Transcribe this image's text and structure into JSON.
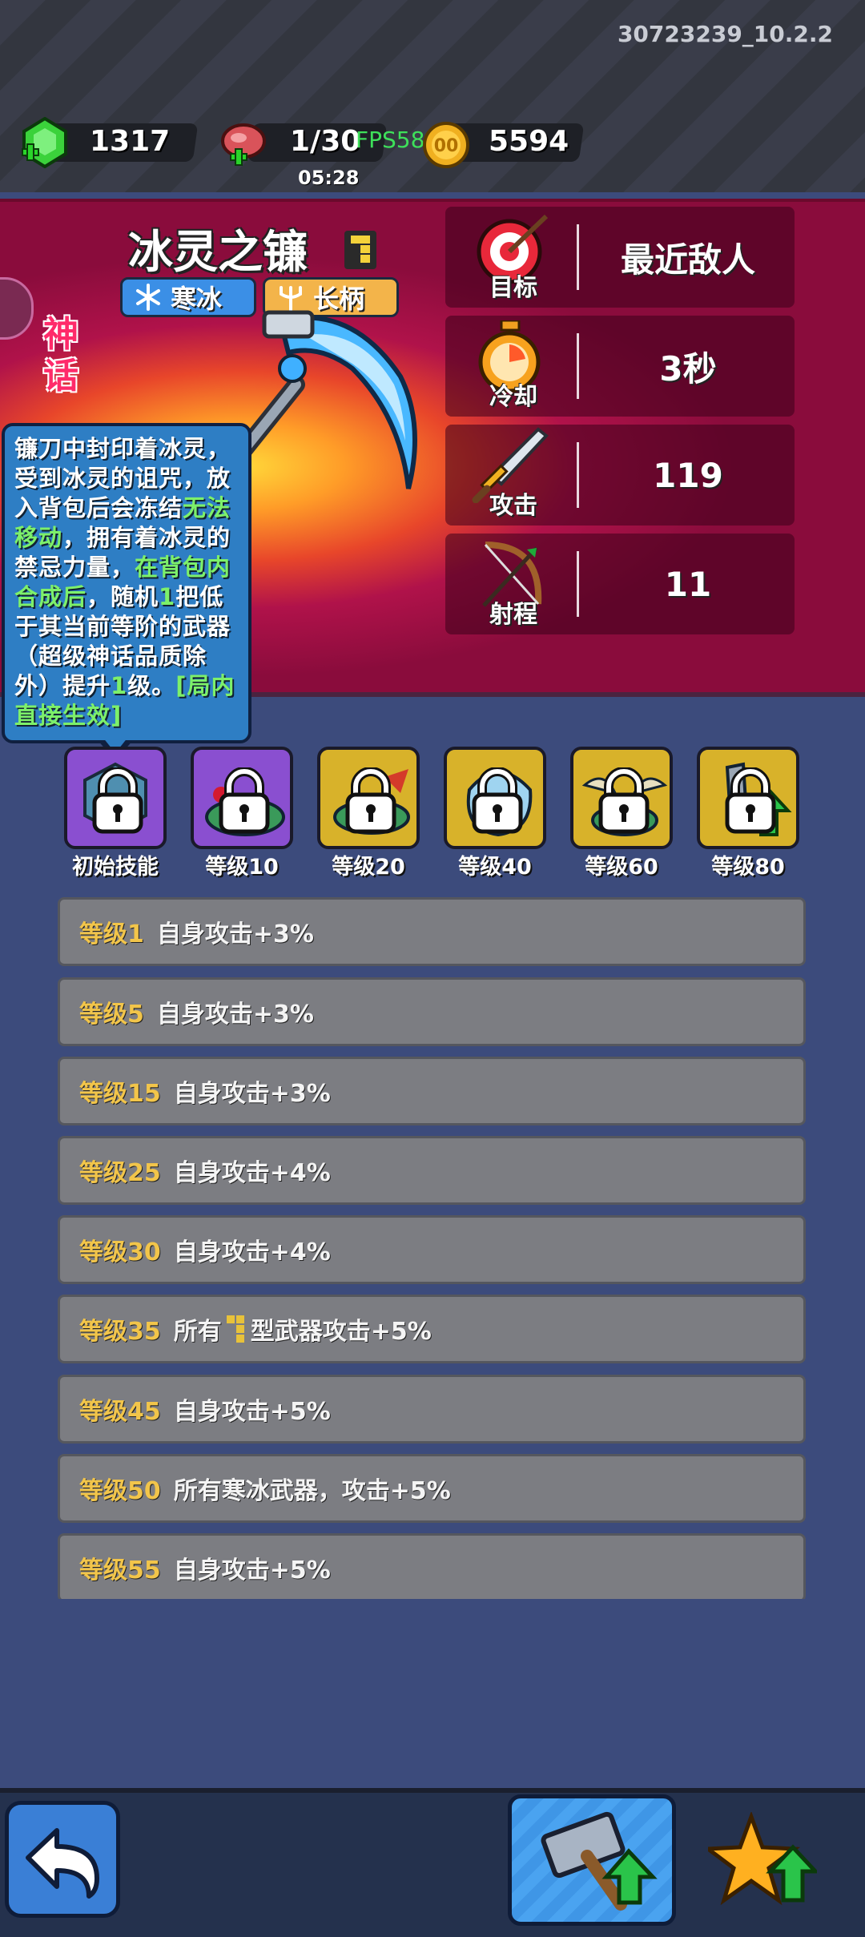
{
  "version": "30723239_10.2.2",
  "resources": {
    "gems": "1317",
    "stamina": "1/30",
    "fps": "FPS58",
    "timer": "05:28",
    "coins": "5594"
  },
  "weapon": {
    "name": "冰灵之镰",
    "rarity": "神话",
    "tags": [
      {
        "label": "寒冰",
        "icon": "snowflake-icon"
      },
      {
        "label": "长柄",
        "icon": "trident-icon"
      }
    ]
  },
  "stats": [
    {
      "label": "目标",
      "value": "最近敌人",
      "icon": "target-icon"
    },
    {
      "label": "冷却",
      "value": "3秒",
      "icon": "stopwatch-icon"
    },
    {
      "label": "攻击",
      "value": "119",
      "icon": "sword-icon"
    },
    {
      "label": "射程",
      "value": "11",
      "icon": "bow-icon"
    }
  ],
  "tooltip": {
    "p1": "镰刀中封印着冰灵，受到冰灵的诅咒，放入背包后会冻结",
    "p2": "无法移动",
    "p3": "，拥有着冰灵的禁忌力量，",
    "p4": "在背包内合成后",
    "p5": "，随机",
    "p6": "1",
    "p7": "把低于其当前等阶的武器（超级神话品质除外）提升",
    "p8": "1",
    "p9": "级。",
    "p10": "[局内直接生效]"
  },
  "skills": [
    {
      "label": "初始技能"
    },
    {
      "label": "等级10"
    },
    {
      "label": "等级20"
    },
    {
      "label": "等级40"
    },
    {
      "label": "等级60"
    },
    {
      "label": "等级80"
    }
  ],
  "levels": [
    {
      "tag": "等级1",
      "desc": "自身攻击+3%"
    },
    {
      "tag": "等级5",
      "desc": "自身攻击+3%"
    },
    {
      "tag": "等级15",
      "desc": "自身攻击+3%"
    },
    {
      "tag": "等级25",
      "desc": "自身攻击+4%"
    },
    {
      "tag": "等级30",
      "desc": "自身攻击+4%"
    },
    {
      "tag": "等级35",
      "desc_a": "所有",
      "desc_b": "型武器攻击+5%"
    },
    {
      "tag": "等级45",
      "desc": "自身攻击+5%"
    },
    {
      "tag": "等级50",
      "desc": "所有寒冰武器，攻击+5%"
    },
    {
      "tag": "等级55",
      "desc": "自身攻击+5%"
    }
  ],
  "colors": {
    "accent_gold": "#f2c54a",
    "tooltip_green": "#7df06a",
    "panel_crimson": "#8a0c3c"
  }
}
